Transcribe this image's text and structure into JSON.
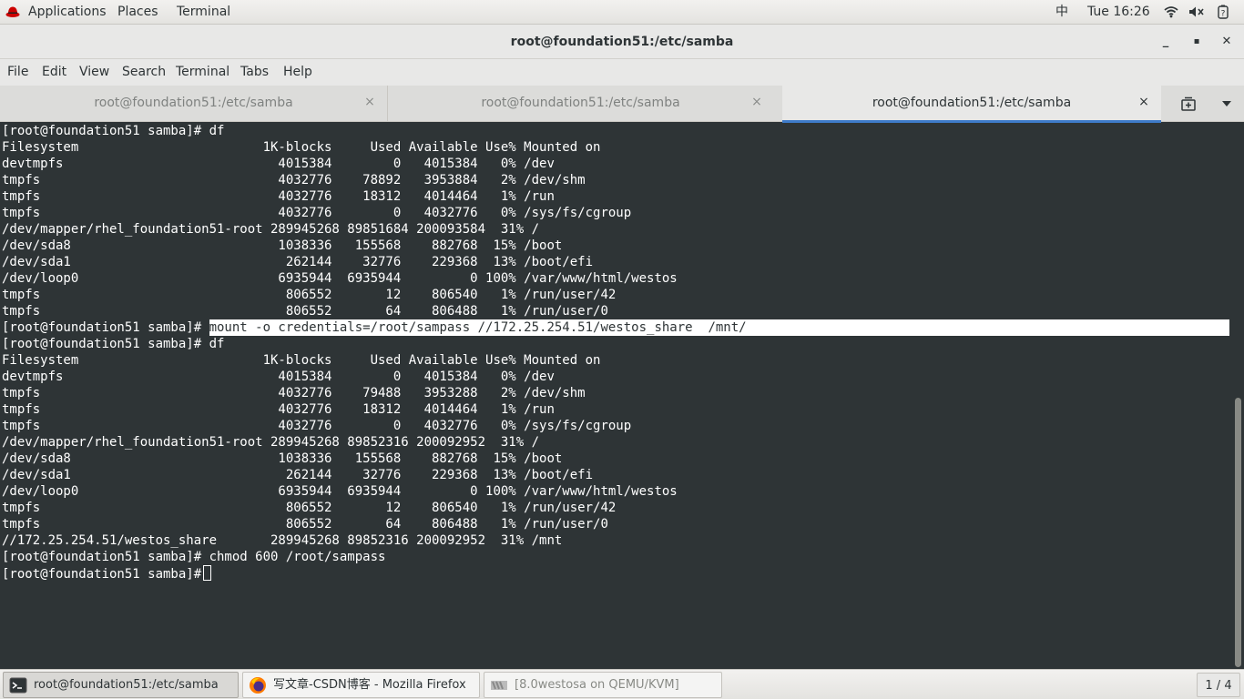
{
  "topbar": {
    "applications": "Applications",
    "places": "Places",
    "terminal": "Terminal",
    "input_method": "中",
    "clock": "Tue 16:26",
    "icons": [
      "redhat-icon",
      "wifi-icon",
      "volume-icon",
      "power-icon"
    ]
  },
  "window": {
    "title": "root@foundation51:/etc/samba",
    "minimize": "_",
    "maximize": "▪",
    "close": "✕"
  },
  "menubar": [
    "File",
    "Edit",
    "View",
    "Search",
    "Terminal",
    "Tabs",
    "Help"
  ],
  "tabs": [
    {
      "label": "root@foundation51:/etc/samba",
      "close": "×",
      "active": false
    },
    {
      "label": "root@foundation51:/etc/samba",
      "close": "×",
      "active": false
    },
    {
      "label": "root@foundation51:/etc/samba",
      "close": "×",
      "active": true
    }
  ],
  "terminal": {
    "lines": [
      {
        "text": "[root@foundation51 samba]# df"
      },
      {
        "text": "Filesystem                        1K-blocks     Used Available Use% Mounted on"
      },
      {
        "text": "devtmpfs                            4015384        0   4015384   0% /dev"
      },
      {
        "text": "tmpfs                               4032776    78892   3953884   2% /dev/shm"
      },
      {
        "text": "tmpfs                               4032776    18312   4014464   1% /run"
      },
      {
        "text": "tmpfs                               4032776        0   4032776   0% /sys/fs/cgroup"
      },
      {
        "text": "/dev/mapper/rhel_foundation51-root 289945268 89851684 200093584  31% /"
      },
      {
        "text": "/dev/sda8                           1038336   155568    882768  15% /boot"
      },
      {
        "text": "/dev/sda1                            262144    32776    229368  13% /boot/efi"
      },
      {
        "text": "/dev/loop0                          6935944  6935944         0 100% /var/www/html/westos"
      },
      {
        "text": "tmpfs                                806552       12    806540   1% /run/user/42"
      },
      {
        "text": "tmpfs                                806552       64    806488   1% /run/user/0"
      },
      {
        "prompt": "[root@foundation51 samba]# ",
        "highlight": "mount -o credentials=/root/sampass //172.25.254.51/westos_share  /mnt/"
      },
      {
        "text": "[root@foundation51 samba]# df"
      },
      {
        "text": "Filesystem                        1K-blocks     Used Available Use% Mounted on"
      },
      {
        "text": "devtmpfs                            4015384        0   4015384   0% /dev"
      },
      {
        "text": "tmpfs                               4032776    79488   3953288   2% /dev/shm"
      },
      {
        "text": "tmpfs                               4032776    18312   4014464   1% /run"
      },
      {
        "text": "tmpfs                               4032776        0   4032776   0% /sys/fs/cgroup"
      },
      {
        "text": "/dev/mapper/rhel_foundation51-root 289945268 89852316 200092952  31% /"
      },
      {
        "text": "/dev/sda8                           1038336   155568    882768  15% /boot"
      },
      {
        "text": "/dev/sda1                            262144    32776    229368  13% /boot/efi"
      },
      {
        "text": "/dev/loop0                          6935944  6935944         0 100% /var/www/html/westos"
      },
      {
        "text": "tmpfs                                806552       12    806540   1% /run/user/42"
      },
      {
        "text": "tmpfs                                806552       64    806488   1% /run/user/0"
      },
      {
        "text": "//172.25.254.51/westos_share       289945268 89852316 200092952  31% /mnt"
      },
      {
        "text": "[root@foundation51 samba]# chmod 600 /root/sampass"
      }
    ],
    "current_prompt": "[root@foundation51 samba]#"
  },
  "taskbar": {
    "items": [
      {
        "label": "root@foundation51:/etc/samba",
        "icon": "terminal-icon"
      },
      {
        "label": "写文章-CSDN博客 - Mozilla Firefox",
        "icon": "firefox-icon"
      },
      {
        "label": "[8.0westosa on QEMU/KVM]",
        "icon": "virt-manager-icon"
      }
    ],
    "workspace": "1 / 4"
  }
}
